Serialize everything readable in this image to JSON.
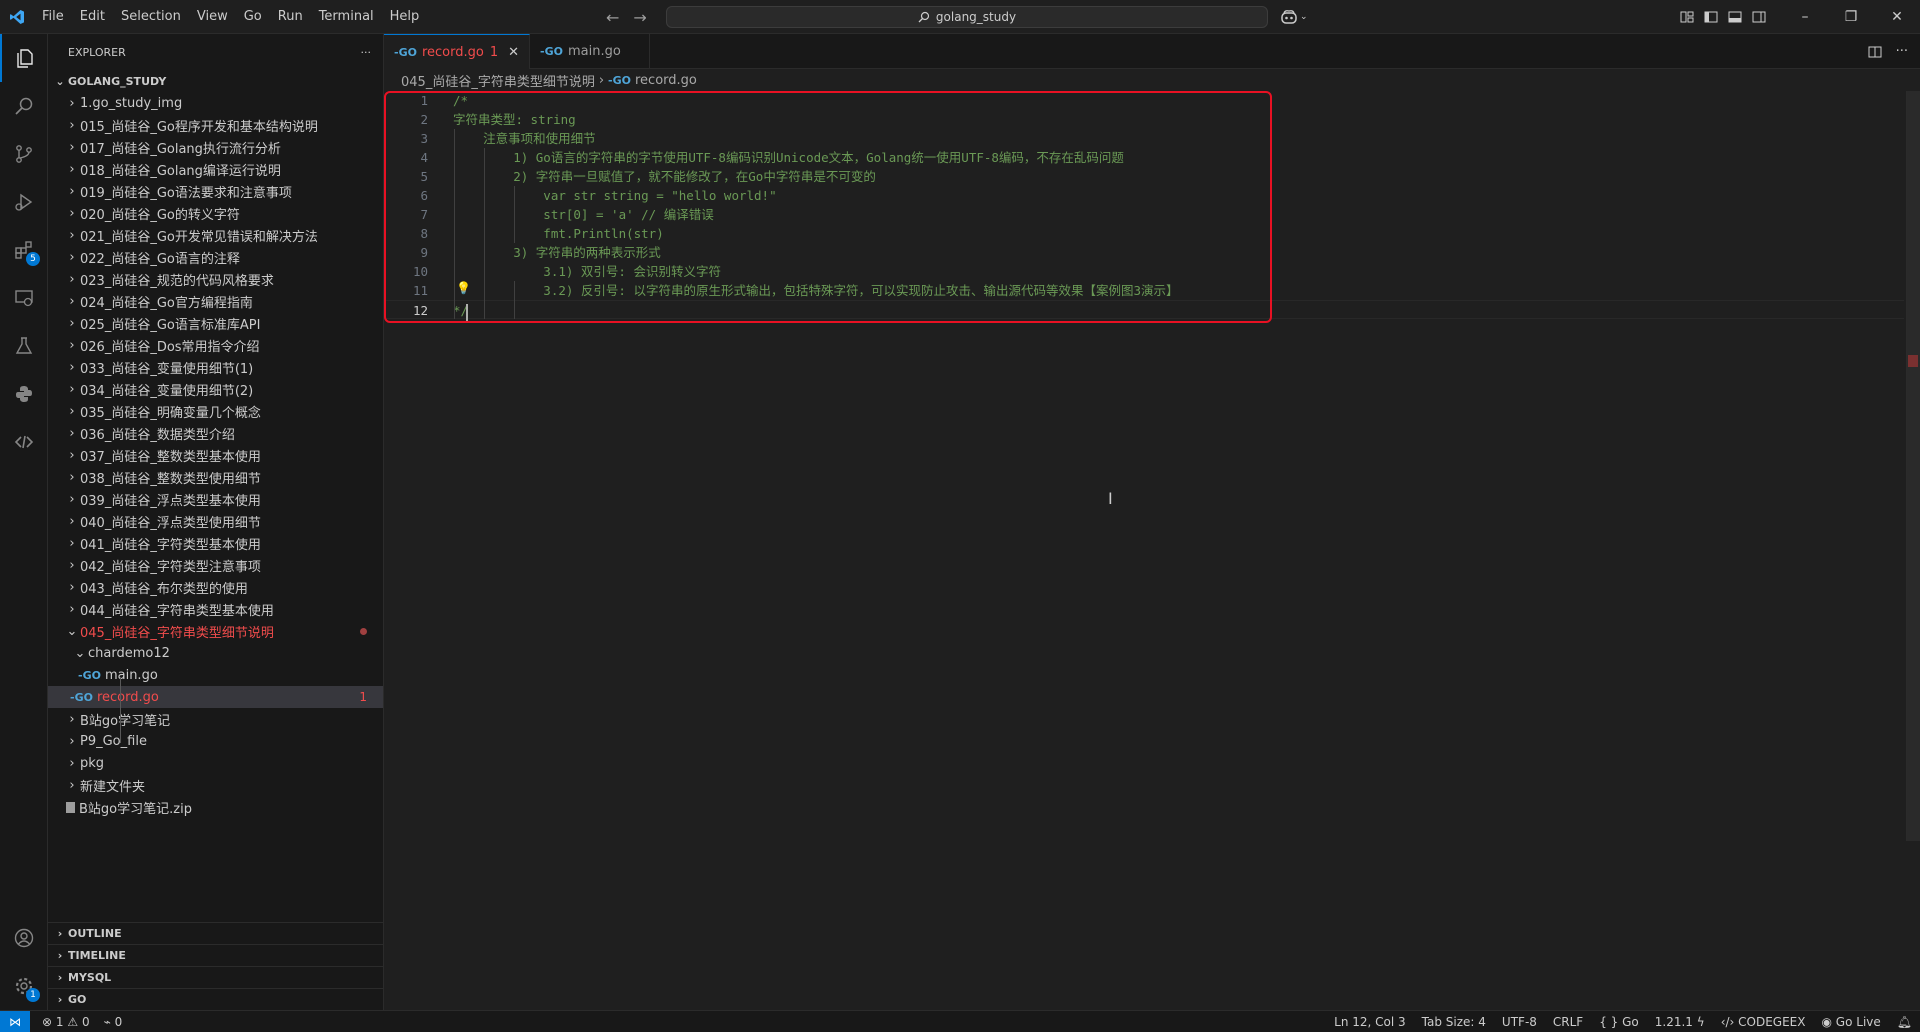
{
  "titlebar": {
    "menu": [
      "File",
      "Edit",
      "Selection",
      "View",
      "Go",
      "Run",
      "Terminal",
      "Help"
    ],
    "search_text": "golang_study",
    "controls": {
      "minimize": "–",
      "restore": "❐",
      "close": "✕"
    }
  },
  "activity_bar": {
    "extensions_badge": "5",
    "settings_badge": "1"
  },
  "sidebar": {
    "title": "EXPLORER",
    "more": "···",
    "root": "GOLANG_STUDY",
    "items": [
      "1.go_study_img",
      "015_尚硅谷_Go程序开发和基本结构说明",
      "017_尚硅谷_Golang执行流行分析",
      "018_尚硅谷_Golang编译运行说明",
      "019_尚硅谷_Go语法要求和注意事项",
      "020_尚硅谷_Go的转义字符",
      "021_尚硅谷_Go开发常见错误和解决方法",
      "022_尚硅谷_Go语言的注释",
      "023_尚硅谷_规范的代码风格要求",
      "024_尚硅谷_Go官方编程指南",
      "025_尚硅谷_Go语言标准库API",
      "026_尚硅谷_Dos常用指令介绍",
      "033_尚硅谷_变量使用细节(1)",
      "034_尚硅谷_变量使用细节(2)",
      "035_尚硅谷_明确变量几个概念",
      "036_尚硅谷_数据类型介绍",
      "037_尚硅谷_整数类型基本使用",
      "038_尚硅谷_整数类型使用细节",
      "039_尚硅谷_浮点类型基本使用",
      "040_尚硅谷_浮点类型使用细节",
      "041_尚硅谷_字符类型基本使用",
      "042_尚硅谷_字符类型注意事项",
      "043_尚硅谷_布尔类型的使用",
      "044_尚硅谷_字符串类型基本使用"
    ],
    "open_folder": "045_尚硅谷_字符串类型细节说明",
    "sub_folder": "chardemo12",
    "main_file": "main.go",
    "record_file": "record.go",
    "record_problems": "1",
    "after_items": [
      "B站go学习笔记",
      "P9_Go_file",
      "pkg",
      "新建文件夹"
    ],
    "zip_file": "B站go学习笔记.zip",
    "panels": [
      "OUTLINE",
      "TIMELINE",
      "MYSQL",
      "GO"
    ]
  },
  "tabs": [
    {
      "label": "record.go",
      "problems": "1"
    },
    {
      "label": "main.go"
    }
  ],
  "breadcrumb": {
    "folder": "045_尚硅谷_字符串类型细节说明",
    "file": "record.go"
  },
  "editor": {
    "lines": [
      "/*",
      "字符串类型: string",
      "    注意事项和使用细节",
      "        1) Go语言的字符串的字节使用UTF-8编码识别Unicode文本，Golang统一使用UTF-8编码，不存在乱码问题",
      "        2) 字符串一旦赋值了，就不能修改了，在Go中字符串是不可变的",
      "            var str string = \"hello world!\"",
      "            str[0] = 'a' // 编译错误",
      "            fmt.Println(str)",
      "        3) 字符串的两种表示形式",
      "            3.1) 双引号: 会识别转义字符",
      "            3.2) 反引号: 以字符串的原生形式输出，包括特殊字符，可以实现防止攻击、输出源代码等效果【案例图3演示】",
      "*/"
    ],
    "current_line": 12
  },
  "statusbar": {
    "errors": "1",
    "warnings": "0",
    "ports": "0",
    "position": "Ln 12, Col 3",
    "tab_size": "Tab Size: 4",
    "encoding": "UTF-8",
    "eol": "CRLF",
    "language": "Go",
    "go_version": "1.21.1",
    "codegeex": "CODEGEEX",
    "go_live": "Go Live"
  }
}
